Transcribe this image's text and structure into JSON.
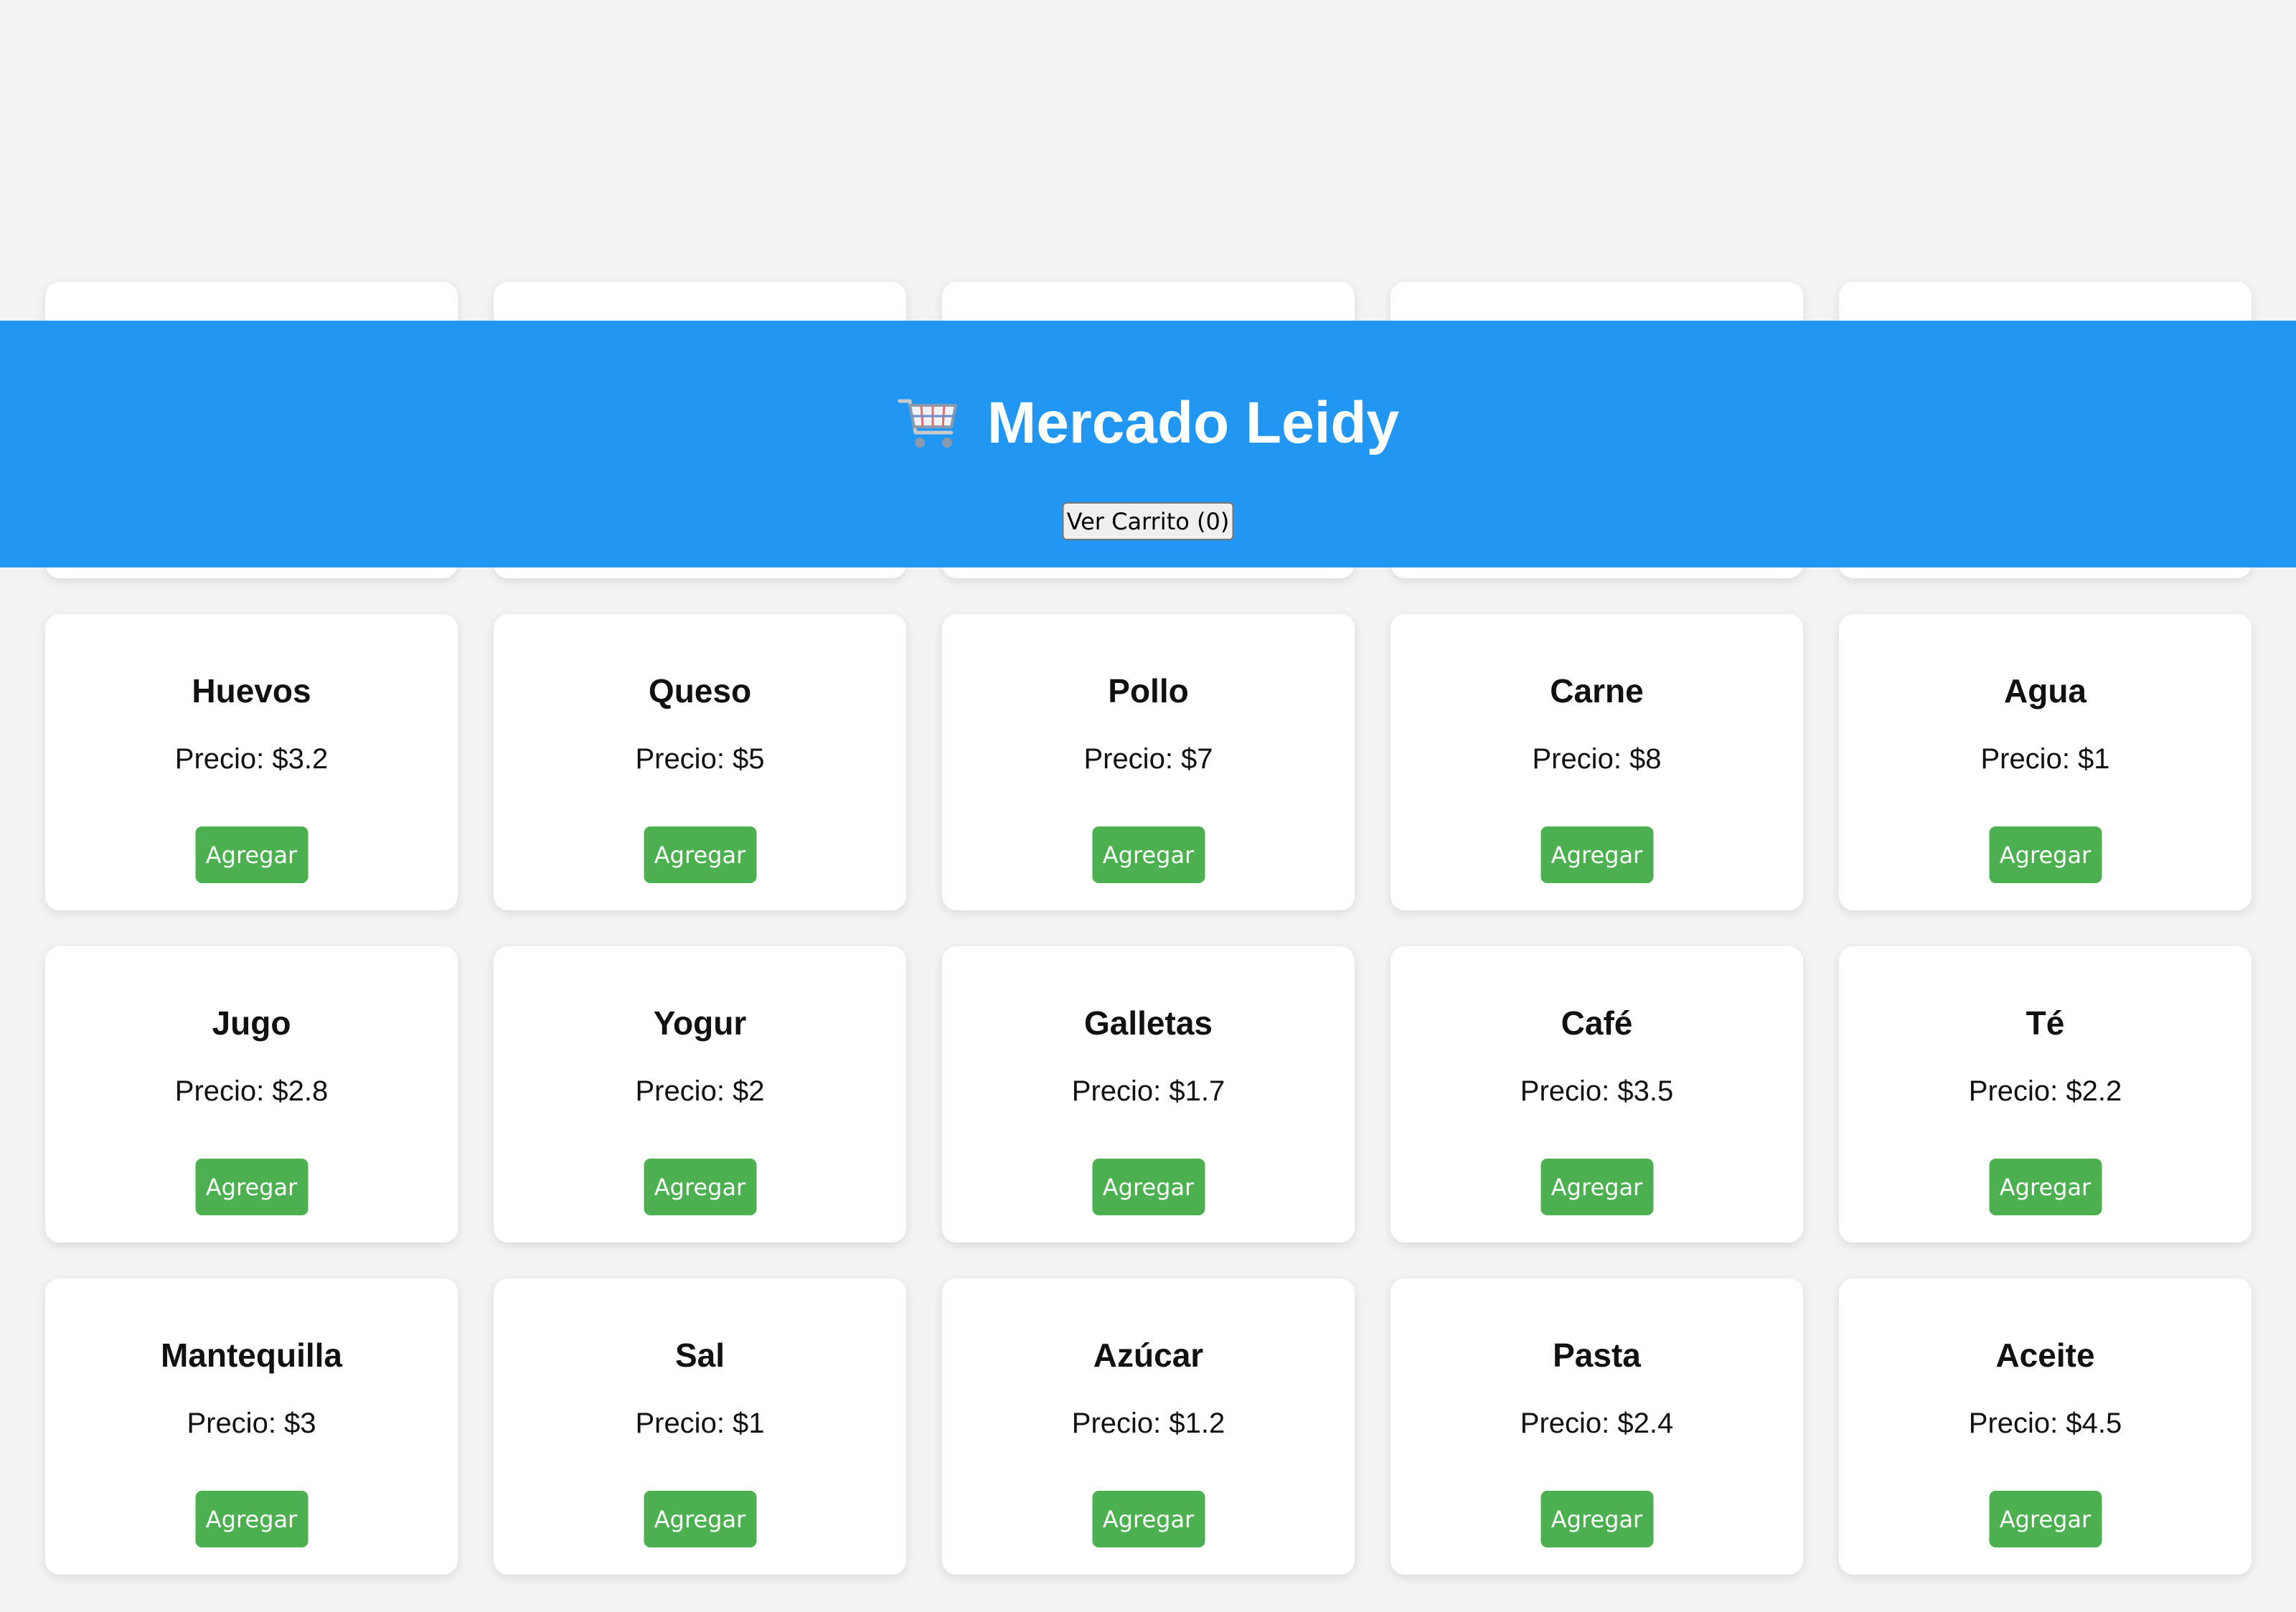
{
  "header": {
    "title": "Mercado Leidy",
    "icon": "shopping-cart-icon",
    "cart_button_label": "Ver Carrito (0)",
    "background_color": "#2196f3"
  },
  "products": [
    {
      "name": "",
      "price_text": "",
      "button_label": ""
    },
    {
      "name": "",
      "price_text": "",
      "button_label": ""
    },
    {
      "name": "",
      "price_text": "",
      "button_label": ""
    },
    {
      "name": "",
      "price_text": "",
      "button_label": ""
    },
    {
      "name": "",
      "price_text": "",
      "button_label": ""
    },
    {
      "name": "Huevos",
      "price_text": "Precio: $3.2",
      "button_label": "Agregar"
    },
    {
      "name": "Queso",
      "price_text": "Precio: $5",
      "button_label": "Agregar"
    },
    {
      "name": "Pollo",
      "price_text": "Precio: $7",
      "button_label": "Agregar"
    },
    {
      "name": "Carne",
      "price_text": "Precio: $8",
      "button_label": "Agregar"
    },
    {
      "name": "Agua",
      "price_text": "Precio: $1",
      "button_label": "Agregar"
    },
    {
      "name": "Jugo",
      "price_text": "Precio: $2.8",
      "button_label": "Agregar"
    },
    {
      "name": "Yogur",
      "price_text": "Precio: $2",
      "button_label": "Agregar"
    },
    {
      "name": "Galletas",
      "price_text": "Precio: $1.7",
      "button_label": "Agregar"
    },
    {
      "name": "Café",
      "price_text": "Precio: $3.5",
      "button_label": "Agregar"
    },
    {
      "name": "Té",
      "price_text": "Precio: $2.2",
      "button_label": "Agregar"
    },
    {
      "name": "Mantequilla",
      "price_text": "Precio: $3",
      "button_label": "Agregar"
    },
    {
      "name": "Sal",
      "price_text": "Precio: $1",
      "button_label": "Agregar"
    },
    {
      "name": "Azúcar",
      "price_text": "Precio: $1.2",
      "button_label": "Agregar"
    },
    {
      "name": "Pasta",
      "price_text": "Precio: $2.4",
      "button_label": "Agregar"
    },
    {
      "name": "Aceite",
      "price_text": "Precio: $4.5",
      "button_label": "Agregar"
    }
  ],
  "colors": {
    "page_background": "#f3f3f3",
    "add_button": "#4caf50",
    "card_background": "#ffffff"
  }
}
